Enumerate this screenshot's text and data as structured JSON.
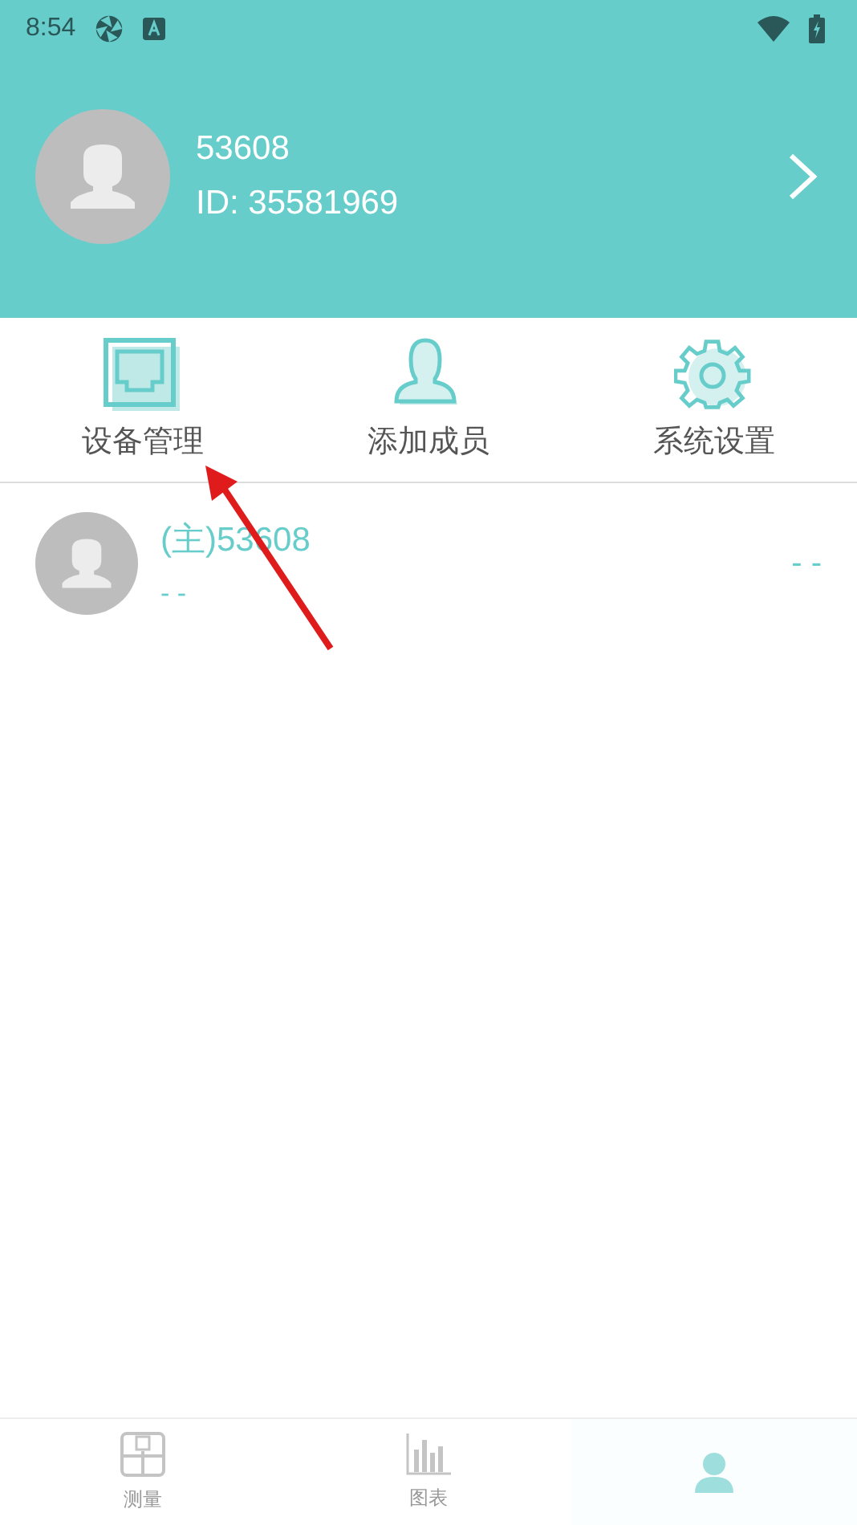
{
  "status_bar": {
    "time": "8:54"
  },
  "profile": {
    "name": "53608",
    "id": "ID: 35581969"
  },
  "actions": [
    {
      "kind": "device",
      "label": "设备管理"
    },
    {
      "kind": "member",
      "label": "添加成员"
    },
    {
      "kind": "settings",
      "label": "系统设置"
    }
  ],
  "members": [
    {
      "name": "(主)53608",
      "subtitle": "- -",
      "value": "- -"
    }
  ],
  "annotation": {
    "kind": "arrow"
  },
  "tabs": [
    {
      "kind": "measure",
      "label": "测量",
      "selected": false
    },
    {
      "kind": "chart",
      "label": "图表",
      "selected": false
    },
    {
      "kind": "me",
      "selected": true
    }
  ]
}
